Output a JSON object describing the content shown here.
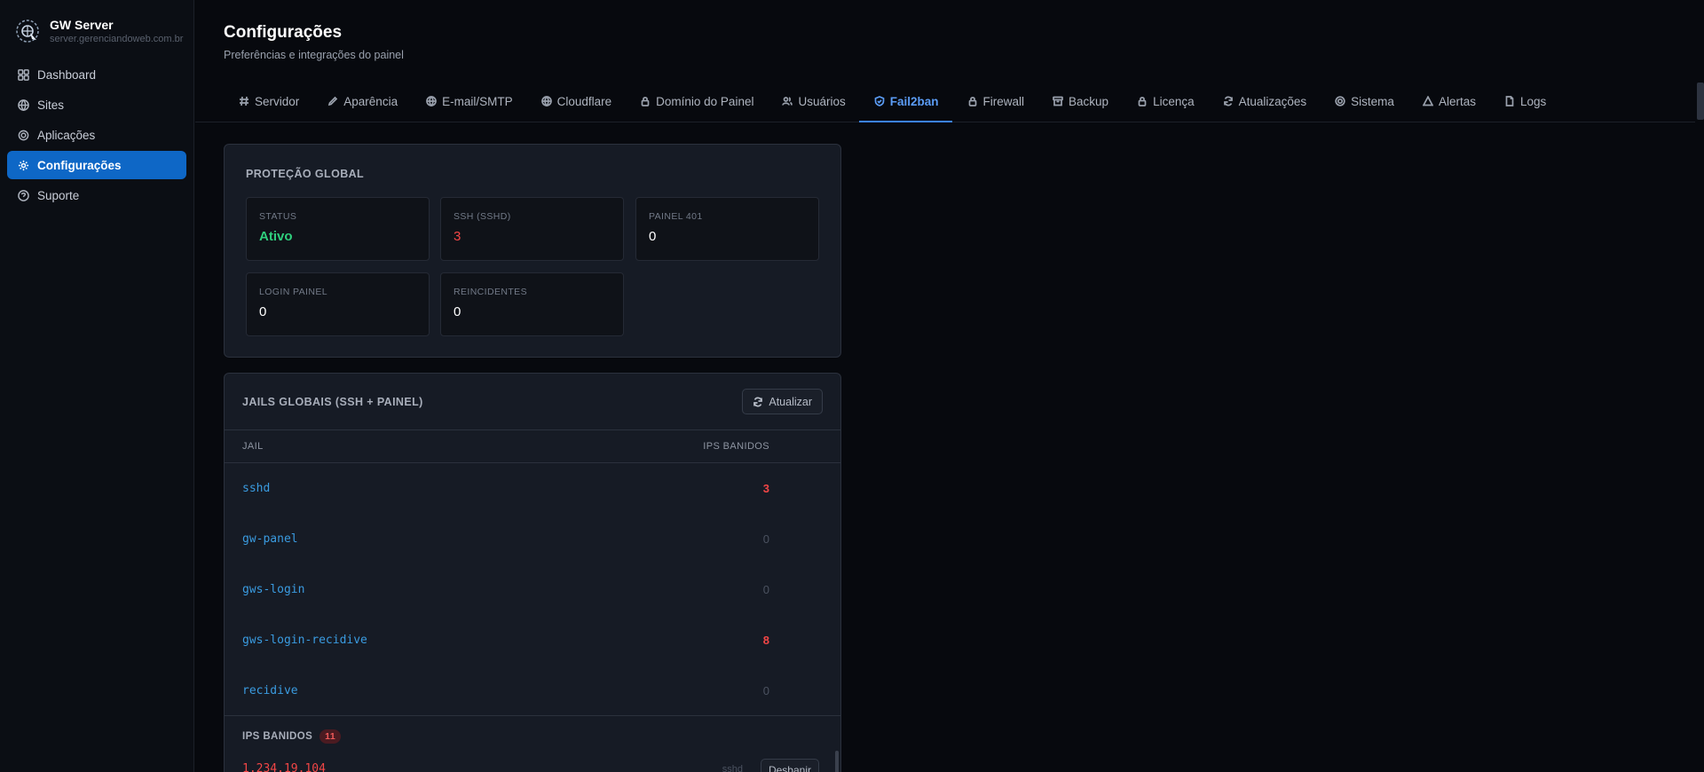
{
  "brand": {
    "name": "GW Server",
    "host": "server.gerenciandoweb.com.br"
  },
  "sidebar": {
    "items": [
      {
        "label": "Dashboard",
        "icon": "grid-icon",
        "active": false
      },
      {
        "label": "Sites",
        "icon": "globe-icon",
        "active": false
      },
      {
        "label": "Aplicações",
        "icon": "chip-icon",
        "active": false
      },
      {
        "label": "Configurações",
        "icon": "gear-icon",
        "active": true
      },
      {
        "label": "Suporte",
        "icon": "help-icon",
        "active": false
      }
    ]
  },
  "header": {
    "title": "Configurações",
    "subtitle": "Preferências e integrações do painel"
  },
  "tabs": [
    {
      "label": "Servidor",
      "icon": "hash-icon"
    },
    {
      "label": "Aparência",
      "icon": "pen-icon"
    },
    {
      "label": "E-mail/SMTP",
      "icon": "globe-icon"
    },
    {
      "label": "Cloudflare",
      "icon": "globe-icon"
    },
    {
      "label": "Domínio do Painel",
      "icon": "lock-icon"
    },
    {
      "label": "Usuários",
      "icon": "users-icon"
    },
    {
      "label": "Fail2ban",
      "icon": "shield-icon",
      "active": true
    },
    {
      "label": "Firewall",
      "icon": "lock-icon"
    },
    {
      "label": "Backup",
      "icon": "archive-icon"
    },
    {
      "label": "Licença",
      "icon": "lock-icon"
    },
    {
      "label": "Atualizações",
      "icon": "refresh-icon"
    },
    {
      "label": "Sistema",
      "icon": "chip-icon"
    },
    {
      "label": "Alertas",
      "icon": "alert-icon"
    },
    {
      "label": "Logs",
      "icon": "file-icon"
    }
  ],
  "global": {
    "title": "PROTEÇÃO GLOBAL",
    "stats": [
      {
        "label": "STATUS",
        "value": "Ativo",
        "color": "#2fcf7d"
      },
      {
        "label": "SSH (SSHD)",
        "value": "3",
        "color": "#f24646"
      },
      {
        "label": "PAINEL 401",
        "value": "0",
        "color": "#ffffff"
      },
      {
        "label": "LOGIN PAINEL",
        "value": "0",
        "color": "#ffffff"
      },
      {
        "label": "REINCIDENTES",
        "value": "0",
        "color": "#ffffff"
      }
    ]
  },
  "jails": {
    "title": "JAILS GLOBAIS (SSH + PAINEL)",
    "refresh_label": "Atualizar",
    "col_jail": "JAIL",
    "col_banned": "IPS BANIDOS",
    "rows": [
      {
        "name": "sshd",
        "count": "3",
        "hot": true
      },
      {
        "name": "gw-panel",
        "count": "0",
        "hot": false
      },
      {
        "name": "gws-login",
        "count": "0",
        "hot": false
      },
      {
        "name": "gws-login-recidive",
        "count": "8",
        "hot": true
      },
      {
        "name": "recidive",
        "count": "0",
        "hot": false
      }
    ]
  },
  "banned": {
    "title": "IPS BANIDOS",
    "count": "11",
    "first_ip": "1.234.19.104",
    "first_jail": "sshd",
    "unban_label": "Desbanir"
  }
}
